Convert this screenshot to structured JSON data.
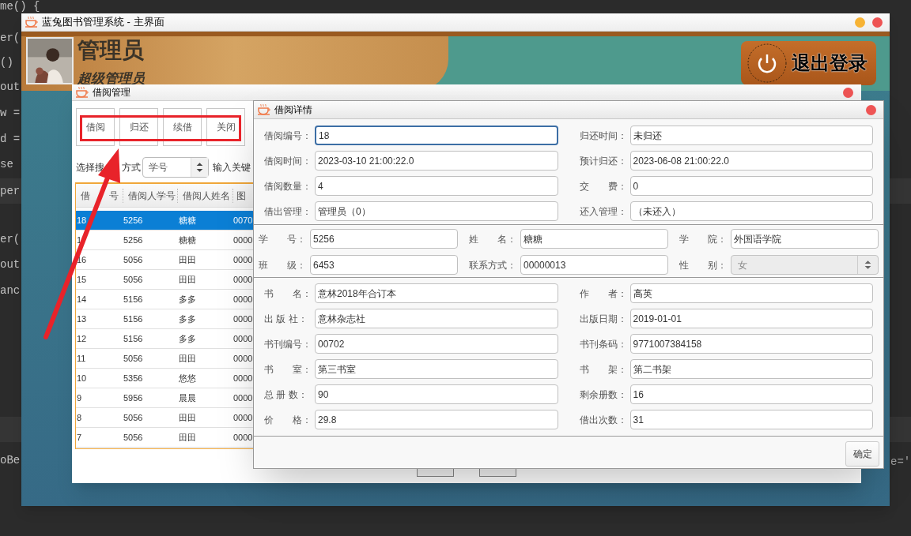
{
  "editor_left_lines": [
    "me() {",
    "er(",
    "()",
    "out",
    "w =",
    "d =",
    "se",
    "per",
    "er(",
    "out",
    "anc",
    "oBe"
  ],
  "editor_right_lines": [
    "e='"
  ],
  "main_window": {
    "title": "蓝兔图书管理系统 - 主界面"
  },
  "header": {
    "user_name": "管理员",
    "role": "超级管理员",
    "logout_label": "退出登录"
  },
  "borrow_window": {
    "title": "借阅管理",
    "buttons": [
      "借阅",
      "归还",
      "续借",
      "关闭"
    ],
    "search_label_parts": [
      "选择搜",
      "方式"
    ],
    "search_mode": "学号",
    "keyword_label": "输入关键",
    "table": {
      "columns": [
        {
          "parts": [
            "借",
            "号"
          ]
        },
        {
          "parts": [
            "借阅人学号"
          ]
        },
        {
          "parts": [
            "借阅人姓名"
          ]
        },
        {
          "parts": [
            "图"
          ]
        }
      ],
      "rows": [
        {
          "cells": [
            "18",
            "5256",
            "糖糖",
            "0070"
          ],
          "selected": true
        },
        {
          "cells": [
            "1",
            "5256",
            "糖糖",
            "0000"
          ],
          "selected": false
        },
        {
          "cells": [
            "16",
            "5056",
            "田田",
            "0000"
          ],
          "selected": false
        },
        {
          "cells": [
            "15",
            "5056",
            "田田",
            "0000"
          ],
          "selected": false
        },
        {
          "cells": [
            "14",
            "5156",
            "多多",
            "0000"
          ],
          "selected": false
        },
        {
          "cells": [
            "13",
            "5156",
            "多多",
            "0000"
          ],
          "selected": false
        },
        {
          "cells": [
            "12",
            "5156",
            "多多",
            "0000"
          ],
          "selected": false
        },
        {
          "cells": [
            "11",
            "5056",
            "田田",
            "0000"
          ],
          "selected": false
        },
        {
          "cells": [
            "10",
            "5356",
            "悠悠",
            "0000"
          ],
          "selected": false
        },
        {
          "cells": [
            "9",
            "5956",
            "晨晨",
            "0000"
          ],
          "selected": false
        },
        {
          "cells": [
            "8",
            "5056",
            "田田",
            "0000"
          ],
          "selected": false
        },
        {
          "cells": [
            "7",
            "5056",
            "田田",
            "0000"
          ],
          "selected": false
        }
      ]
    }
  },
  "detail_dialog": {
    "title": "借阅详情",
    "confirm": "确定",
    "sections": [
      {
        "kind": "pairs",
        "fields": [
          {
            "label": "借阅编号：",
            "value": "18",
            "kind": "text",
            "focused": true
          },
          {
            "label": "归还时间：",
            "value": "未归还",
            "kind": "text",
            "focused": false
          },
          {
            "label": "借阅时间：",
            "value": "2023-03-10 21:00:22.0",
            "kind": "text",
            "focused": false
          },
          {
            "label": "预计归还：",
            "value": "2023-06-08 21:00:22.0",
            "kind": "text",
            "focused": false
          },
          {
            "label": "借阅数量：",
            "value": "4",
            "kind": "text",
            "focused": false
          },
          {
            "label": "交　　费：",
            "value": "0",
            "kind": "text",
            "focused": false
          },
          {
            "label": "借出管理：",
            "value": "管理员（0）",
            "kind": "text",
            "focused": false
          },
          {
            "label": "还入管理：",
            "value": "（未还入）",
            "kind": "text",
            "focused": false
          }
        ]
      },
      {
        "kind": "triples",
        "fields": [
          {
            "label": "学　　号：",
            "value": "5256",
            "kind": "text",
            "focused": false
          },
          {
            "label": "姓　　名：",
            "value": "糖糖",
            "kind": "text",
            "focused": false
          },
          {
            "label": "学　　院：",
            "value": "外国语学院",
            "kind": "text",
            "focused": false
          },
          {
            "label": "班　　级：",
            "value": "6453",
            "kind": "text",
            "focused": false
          },
          {
            "label": "联系方式：",
            "value": "00000013",
            "kind": "text",
            "focused": false
          },
          {
            "label": "性　　别：",
            "value": "女",
            "kind": "select",
            "focused": false,
            "disabled": true
          }
        ]
      },
      {
        "kind": "pairs",
        "fields": [
          {
            "label": "书　　名：",
            "value": "意林2018年合订本",
            "kind": "text",
            "focused": false
          },
          {
            "label": "作　　者：",
            "value": "高英",
            "kind": "text",
            "focused": false
          },
          {
            "label": "出 版 社：",
            "value": "意林杂志社",
            "kind": "text",
            "focused": false
          },
          {
            "label": "出版日期：",
            "value": "2019-01-01",
            "kind": "text",
            "focused": false
          },
          {
            "label": "书刊编号：",
            "value": "00702",
            "kind": "text",
            "focused": false
          },
          {
            "label": "书刊条码：",
            "value": "9771007384158",
            "kind": "text",
            "focused": false
          },
          {
            "label": "书　　室：",
            "value": "第三书室",
            "kind": "text",
            "focused": false
          },
          {
            "label": "书　　架：",
            "value": "第二书架",
            "kind": "text",
            "focused": false
          },
          {
            "label": "总 册 数：",
            "value": "90",
            "kind": "text",
            "focused": false
          },
          {
            "label": "剩余册数：",
            "value": "16",
            "kind": "text",
            "focused": false
          },
          {
            "label": "价　　格：",
            "value": "29.8",
            "kind": "text",
            "focused": false
          },
          {
            "label": "借出次数：",
            "value": "31",
            "kind": "text",
            "focused": false
          }
        ]
      }
    ]
  }
}
